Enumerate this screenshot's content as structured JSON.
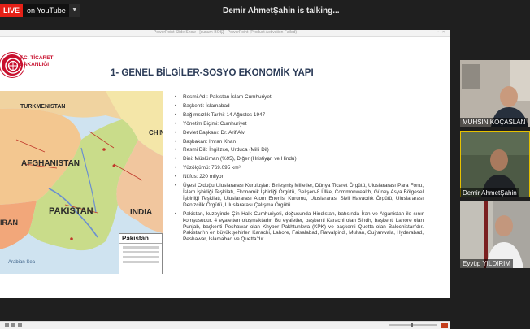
{
  "stream": {
    "live_label": "LIVE",
    "destination": "on YouTube",
    "talking": "Demir AhmetŞahin is talking..."
  },
  "powerpoint": {
    "window_title": "PowerPoint Slide Show - [sunum-BOŞ] - PowerPoint (Product Activation Failed)",
    "organization": {
      "line1": "T.C. TİCARET",
      "line2": "BAKANLIĞI"
    },
    "slide_title": "1- GENEL BİLGİLER-SOSYO EKONOMİK YAPI",
    "map": {
      "title": "Pakistan",
      "labels": [
        "AFGHANISTAN",
        "PAKISTAN",
        "INDIA",
        "IRAN",
        "TURKMENISTAN",
        "CHINA",
        "Arabian Sea"
      ]
    },
    "bullets": [
      "Resmi Adı: Pakistan İslam Cumhuriyeti",
      "Başkenti: İslamabad",
      "Bağımsızlık Tarihi: 14 Ağustos 1947",
      "Yönetim Biçimi: Cumhuriyet",
      "Devlet Başkanı: Dr. Arif Alvi",
      "Başbakan: Imran Khan",
      "Resmi Dili: İngilizce, Urduca (Milli Dil)",
      "Dini: Müslüman (%95), Diğer (Hristiyan ve Hindu)",
      "Yüzölçümü: 769.095 km²",
      "Nüfus: 220 milyon",
      "Üyesi Olduğu Uluslararası Kuruluşlar: Birleşmiş Milletler, Dünya Ticaret Örgütü, Uluslararası Para Fonu, İslam İşbirliği Teşkilatı, Ekonomik İşbirliği Örgütü, Gelişen-8 Ülke, Commonwealth, Güney Asya Bölgesel İşbirliği Teşkilatı, Uluslararası Atom Enerjisi Kurumu, Uluslararası Sivil Havacılık Örgütü, Uluslararası Denizcilik Örgütü, Uluslararası Çalışma Örgütü",
      "Pakistan, kuzeyinde Çin Halk Cumhuriyeti, doğusunda Hindistan, batısında İran ve Afganistan ile sınır komşusudur. 4 eyaletten oluşmaktadır. Bu eyaletler, başkenti Karachi olan Sindh, başkenti Lahore olan Punjab, başkenti Peshawar olan Khyber Pakhtunkwa (KPK) ve başkenti Quetta olan Balochistan'dır. Pakistan'ın en büyük şehirleri Karachi, Lahore, Faisalabad, Rawalpindi, Multan, Gujranwala, Hyderabad, Peshawar, Islamabad ve Quetta'dır."
    ]
  },
  "participants": [
    {
      "name": "MUHSİN KOÇASLAN"
    },
    {
      "name": "Demir AhmetŞahin"
    },
    {
      "name": "Eyyüp YILDIRIM"
    }
  ],
  "colors": {
    "live_red": "#e62117",
    "title_navy": "#2b3b57",
    "ministry_red": "#c8102e",
    "active_speaker": "#e6c100"
  }
}
